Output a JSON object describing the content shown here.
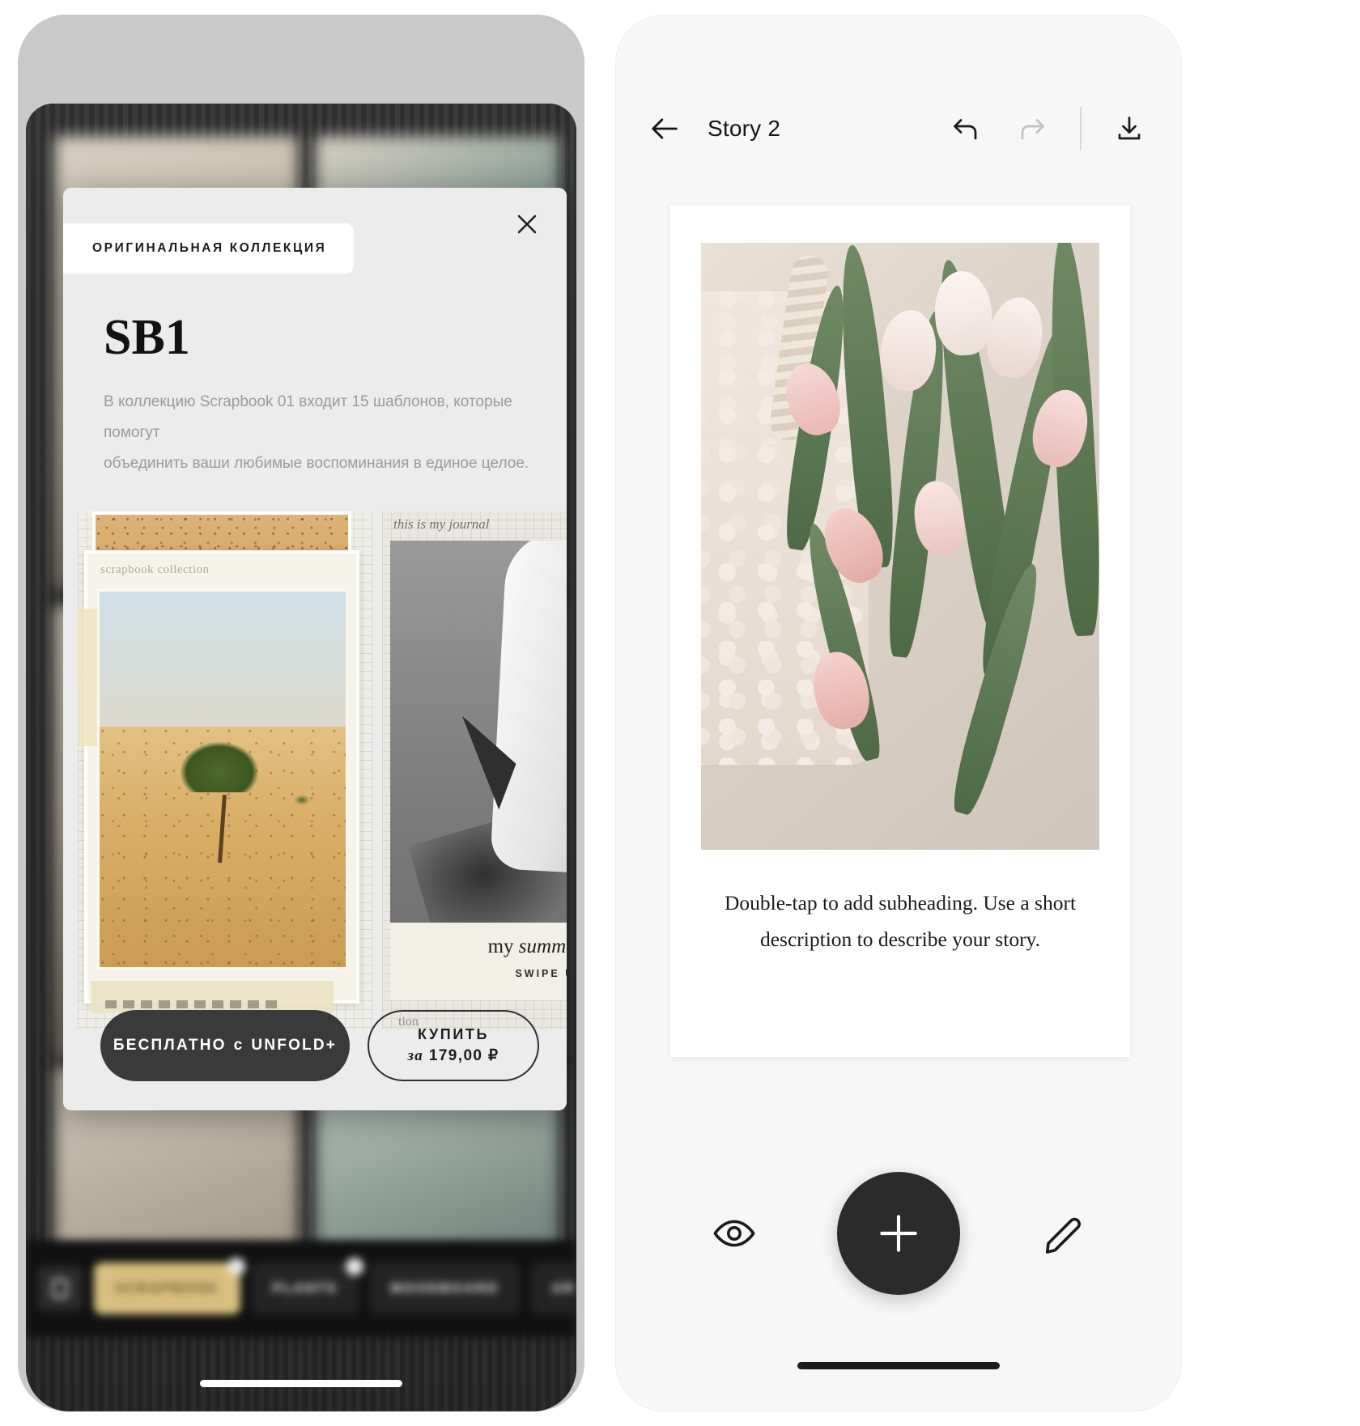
{
  "left_phone": {
    "name": "unfold-template-store",
    "modal": {
      "close_icon": "close-icon",
      "badge": "ОРИГИНАЛЬНАЯ КОЛЛЕКЦИЯ",
      "title": "SB1",
      "description_line1": "В коллекцию Scrapbook 01 входит 15 шаблонов, которые помогут",
      "description_line2": "объединить ваши любимые воспоминания в единое целое.",
      "preview": {
        "card1_note_label": "scrapbook collection",
        "card2_handwriting": "this is my journal",
        "card2_caption_main_plain": "my ",
        "card2_caption_main_italic": "summer tra",
        "card2_caption_sub": "SWIPE UP",
        "card2_footer": "tion"
      },
      "free_button": {
        "prefix": "БЕСПЛАТНО",
        "conjunction": "с",
        "suffix": "UNFOLD+"
      },
      "buy_button": {
        "line1": "КУПИТЬ",
        "line2_prefix": "за",
        "line2_price": "179,00 ₽"
      }
    },
    "tabbar": {
      "lock_icon": "lock-icon",
      "items": [
        {
          "label": "SCRAPBOOK",
          "active": true,
          "badge": true
        },
        {
          "label": "PLANTS",
          "active": false,
          "badge": true
        },
        {
          "label": "MOODBOARD",
          "active": false,
          "badge": false
        },
        {
          "label": "AR",
          "active": false,
          "badge": false
        }
      ]
    }
  },
  "right_phone": {
    "name": "unfold-story-editor",
    "header": {
      "back_icon": "arrow-left-icon",
      "title": "Story 2",
      "undo_icon": "undo-icon",
      "redo_icon": "redo-icon",
      "download_icon": "download-icon"
    },
    "canvas": {
      "photo_alt": "pink-tulips-photo",
      "caption_line1": "Double-tap to add subheading. Use a short",
      "caption_line2": "description to describe your story."
    },
    "bottombar": {
      "preview_icon": "eye-icon",
      "add_icon": "plus-icon",
      "edit_icon": "pencil-icon"
    }
  },
  "colors": {
    "dark": "#2b2b2b",
    "sheet_bg": "#ececec",
    "accent_gold": "#d8bf7f",
    "muted_text": "#9b9b9b"
  }
}
